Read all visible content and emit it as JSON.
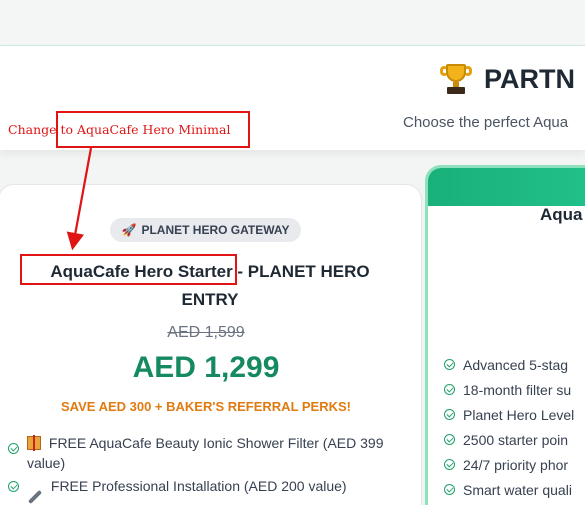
{
  "header": {
    "title": "PARTN",
    "subtitle": "Choose the perfect Aqua"
  },
  "annotation": {
    "text": "Change to AquaCafe Hero Minimal",
    "color": "#e01414"
  },
  "left_card": {
    "badge": "PLANET HERO GATEWAY",
    "title_highlight": "AquaCafe Hero Starter",
    "title_rest": " - PLANET HERO ENTRY",
    "old_price": "AED 1,599",
    "new_price": "AED 1,299",
    "save_text": "SAVE AED 300 + BAKER'S REFERRAL PERKS!",
    "features": [
      {
        "icon": "gift-icon",
        "text": "FREE AquaCafe Beauty Ionic Shower Filter (AED 399 value)"
      },
      {
        "icon": "wrench-icon",
        "text": "FREE Professional Installation (AED 200 value)"
      }
    ]
  },
  "right_card": {
    "title": "Aqua",
    "features": [
      "Advanced 5-stag",
      "18-month filter su",
      "Planet Hero Level",
      "2500 starter poin",
      "24/7 priority phor",
      "Smart water quali"
    ]
  },
  "colors": {
    "accent_green": "#15895f",
    "save_orange": "#e07b12",
    "annotation_red": "#e01414"
  }
}
